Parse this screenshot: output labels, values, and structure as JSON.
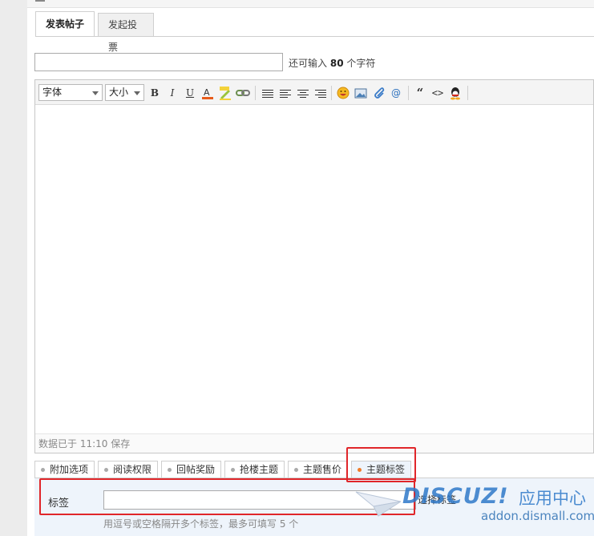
{
  "tabs": [
    {
      "label": "发表帖子",
      "active": true
    },
    {
      "label": "发起投票",
      "active": false
    }
  ],
  "subject": {
    "value": "",
    "counter_prefix": "还可输入",
    "counter_num": "80",
    "counter_suffix": "个字符"
  },
  "toolbar": {
    "font_select": "字体",
    "size_select": "大小",
    "bold": "B",
    "italic": "I",
    "underline": "U",
    "quote": "“",
    "code": "<>"
  },
  "editor": {
    "status": "数据已于 11:10 保存"
  },
  "options": [
    {
      "label": "附加选项",
      "active": false
    },
    {
      "label": "阅读权限",
      "active": false
    },
    {
      "label": "回帖奖励",
      "active": false
    },
    {
      "label": "抢楼主题",
      "active": false
    },
    {
      "label": "主题售价",
      "active": false
    },
    {
      "label": "主题标签",
      "active": true
    }
  ],
  "tags": {
    "label": "标签",
    "value": "",
    "select_button": "选择标签",
    "hint": "用逗号或空格隔开多个标签，最多可填写 5 个"
  },
  "watermark": {
    "logo": "DISCUZ!",
    "cn": "应用中心",
    "url": "addon.dismall.com"
  },
  "colors": {
    "accent_orange": "#f07c28",
    "highlight_red": "#e0262a",
    "tag_panel_bg": "#eef4fb",
    "watermark_blue": "#2f79c9"
  },
  "icons": [
    "bold-icon",
    "italic-icon",
    "underline-icon",
    "font-color-icon",
    "background-color-icon",
    "link-icon",
    "align-justify-icon",
    "align-left-icon",
    "align-center-icon",
    "align-right-icon",
    "smiley-icon",
    "image-icon",
    "attachment-icon",
    "at-icon",
    "quote-icon",
    "code-icon",
    "qq-icon"
  ]
}
